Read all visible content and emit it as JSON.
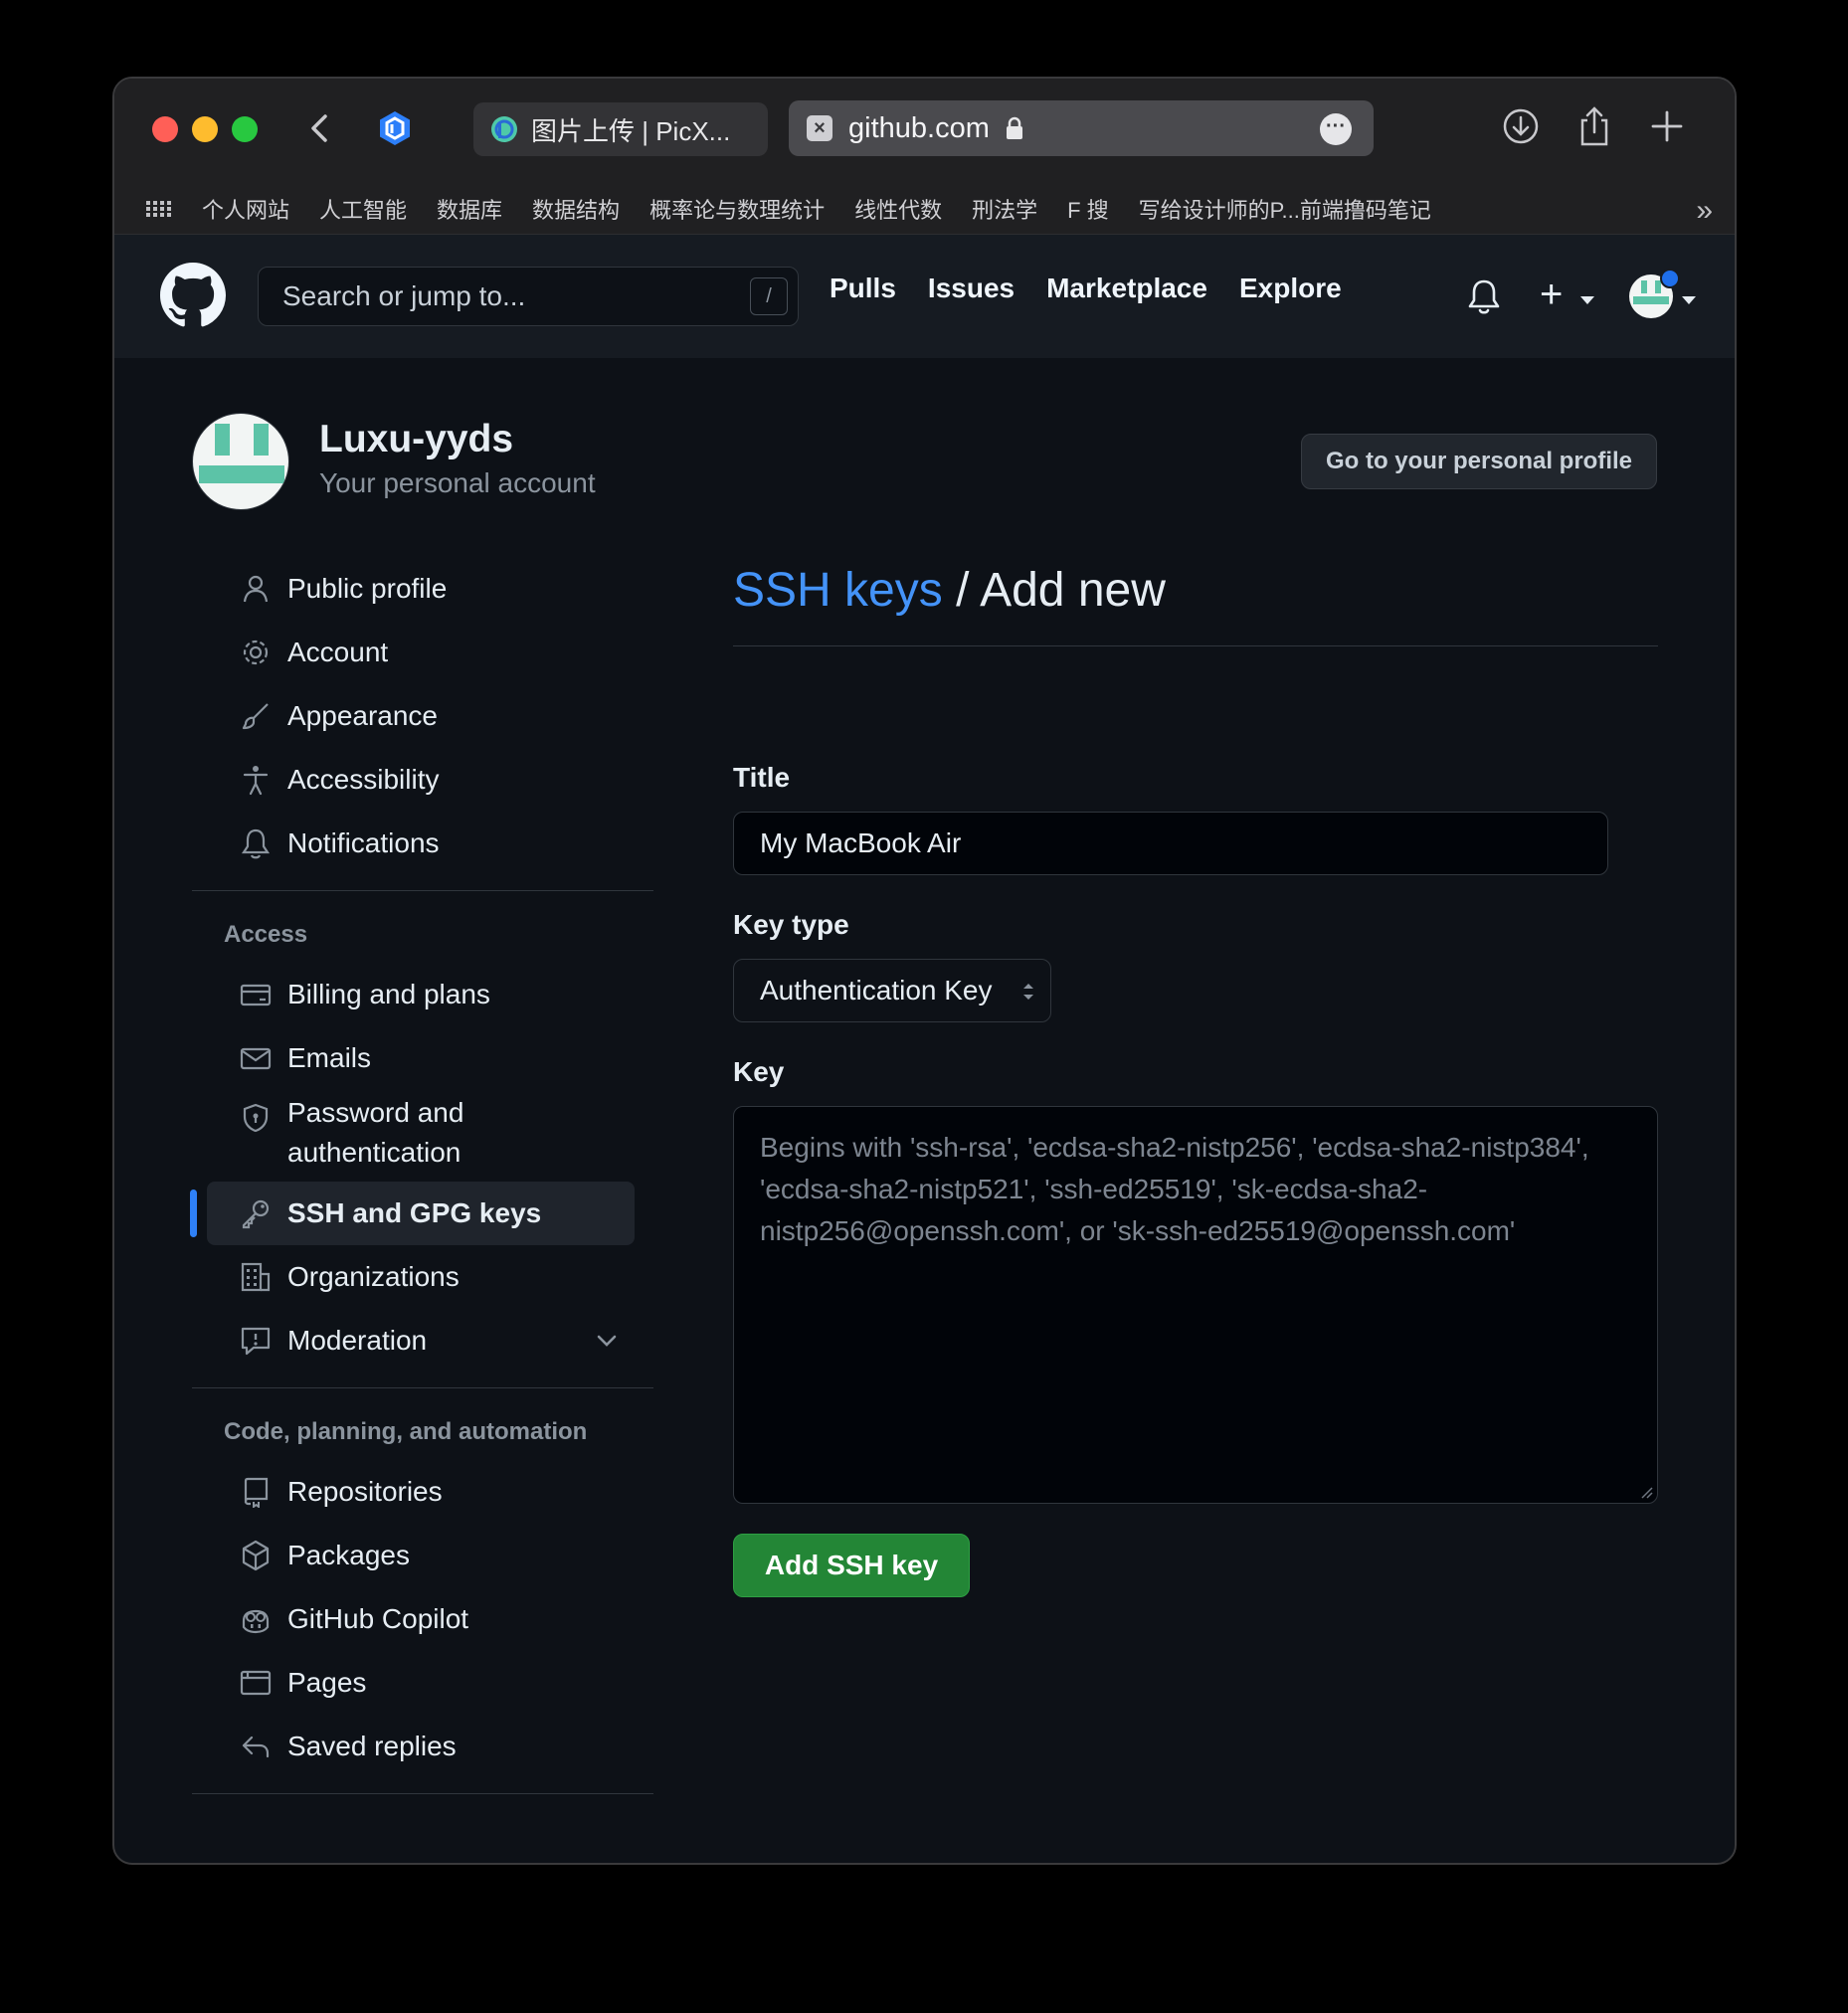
{
  "browser": {
    "tab_inactive_title": "图片上传 | PicX...",
    "address": "github.com",
    "bookmarks": [
      "个人网站",
      "人工智能",
      "数据库",
      "数据结构",
      "概率论与数理统计",
      "线性代数",
      "刑法学",
      "F 搜",
      "写给设计师的P...前端撸码笔记"
    ]
  },
  "header": {
    "search_placeholder": "Search or jump to...",
    "search_shortcut": "/",
    "nav": [
      "Pulls",
      "Issues",
      "Marketplace",
      "Explore"
    ]
  },
  "profile": {
    "name": "Luxu-yyds",
    "subtitle": "Your personal account",
    "button": "Go to your personal profile"
  },
  "sidebar": {
    "group1": [
      "Public profile",
      "Account",
      "Appearance",
      "Accessibility",
      "Notifications"
    ],
    "access_heading": "Access",
    "group2": [
      "Billing and plans",
      "Emails",
      "Password and authentication",
      "SSH and GPG keys",
      "Organizations",
      "Moderation"
    ],
    "code_heading": "Code, planning, and automation",
    "group3": [
      "Repositories",
      "Packages",
      "GitHub Copilot",
      "Pages",
      "Saved replies"
    ]
  },
  "form": {
    "breadcrumb": "SSH keys",
    "separator": " / ",
    "title": "Add new",
    "title_label": "Title",
    "title_value": "My MacBook Air",
    "key_type_label": "Key type",
    "key_type_value": "Authentication Key",
    "key_label": "Key",
    "key_placeholder": "Begins with 'ssh-rsa', 'ecdsa-sha2-nistp256', 'ecdsa-sha2-nistp384', 'ecdsa-sha2-nistp521', 'ssh-ed25519', 'sk-ecdsa-sha2-nistp256@openssh.com', or 'sk-ssh-ed25519@openssh.com'",
    "submit": "Add SSH key"
  },
  "colors": {
    "accent_blue": "#4493f8",
    "primary_green": "#238636",
    "background": "#0d1117"
  }
}
